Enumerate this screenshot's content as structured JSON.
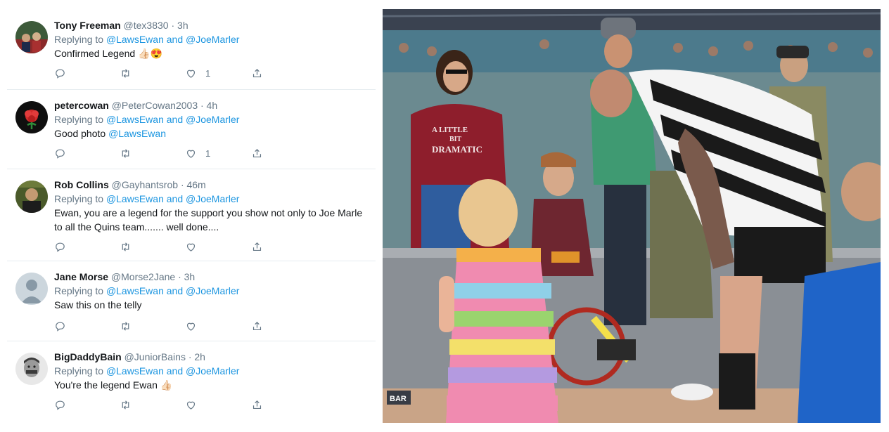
{
  "tweets": [
    {
      "name": "Tony Freeman",
      "handle": "@tex3830",
      "time": "· 3h",
      "replying_prefix": "Replying to",
      "mention1": "@LawsEwan",
      "and": "and",
      "mention2": "@JoeMarler",
      "text": "Confirmed Legend 👍🏻😍",
      "likes": "1"
    },
    {
      "name": "petercowan",
      "handle": "@PeterCowan2003",
      "time": "· 4h",
      "replying_prefix": "Replying to",
      "mention1": "@LawsEwan",
      "and": "and",
      "mention2": "@JoeMarler",
      "text": "Good photo",
      "text_mention": "@LawsEwan",
      "likes": "1"
    },
    {
      "name": "Rob Collins",
      "handle": "@Gayhantsrob",
      "time": "· 46m",
      "replying_prefix": "Replying to",
      "mention1": "@LawsEwan",
      "and": "and",
      "mention2": "@JoeMarler",
      "text": "Ewan, you are a legend for the support you show not only to Joe Marle",
      "text2": "to all the Quins team....... well done....",
      "likes": ""
    },
    {
      "name": "Jane Morse",
      "handle": "@Morse2Jane",
      "time": "· 3h",
      "replying_prefix": "Replying to",
      "mention1": "@LawsEwan",
      "and": "and",
      "mention2": "@JoeMarler",
      "text": "Saw this on the telly",
      "likes": ""
    },
    {
      "name": "BigDaddyBain",
      "handle": "@JuniorBains",
      "time": "· 2h",
      "replying_prefix": "Replying to",
      "mention1": "@LawsEwan",
      "and": "and",
      "mention2": "@JoeMarler",
      "text": "You're the legend Ewan 👍🏻",
      "likes": ""
    }
  ],
  "video": {
    "tv_logo": "BAR",
    "shirt_text_1": "A LITTLE",
    "shirt_text_2": "BIT",
    "shirt_text_3": "DRAMATIC"
  },
  "icons": [
    "reply-icon",
    "retweet-icon",
    "like-icon",
    "share-icon"
  ],
  "colors": {
    "link": "#1b95e0",
    "muted": "#657786",
    "divider": "#e6ecf0"
  }
}
